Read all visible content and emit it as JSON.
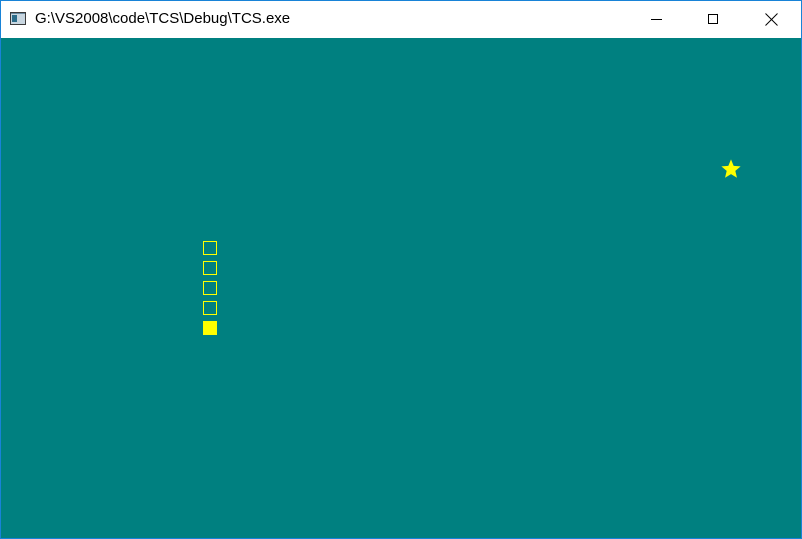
{
  "window": {
    "title": "G:\\VS2008\\code\\TCS\\Debug\\TCS.exe",
    "icon": "console-app-icon"
  },
  "controls": {
    "minimize": "minimize-icon",
    "maximize": "maximize-icon",
    "close": "close-icon"
  },
  "colors": {
    "background": "#008080",
    "snake": "#ffff00",
    "food": "#ffff00",
    "border": "#1883d7"
  },
  "game": {
    "snake_segments": 5,
    "food_icon": "star-icon"
  }
}
